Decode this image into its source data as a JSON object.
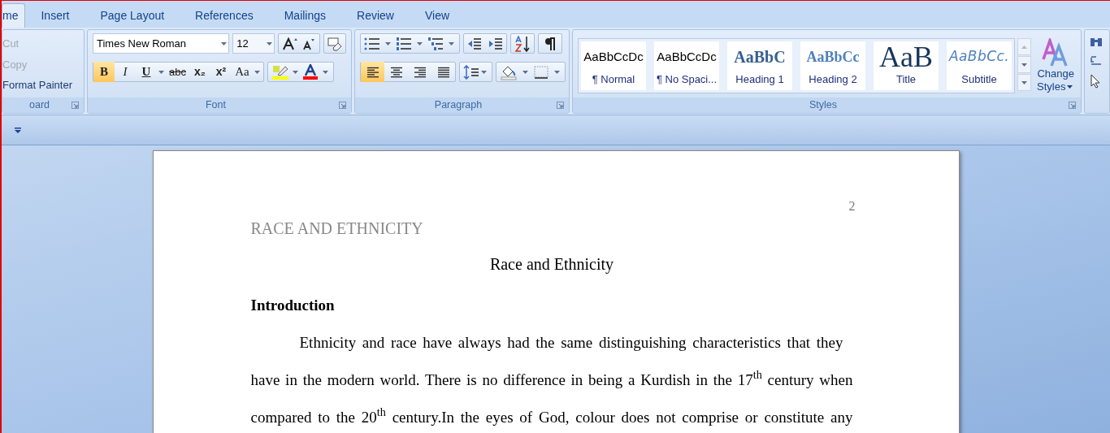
{
  "tabs": [
    {
      "label": "me",
      "selected": true
    },
    {
      "label": "Insert",
      "selected": false
    },
    {
      "label": "Page Layout",
      "selected": false
    },
    {
      "label": "References",
      "selected": false
    },
    {
      "label": "Mailings",
      "selected": false
    },
    {
      "label": "Review",
      "selected": false
    },
    {
      "label": "View",
      "selected": false
    }
  ],
  "clipboard": {
    "items": [
      {
        "label": "Cut",
        "disabled": true
      },
      {
        "label": "Copy",
        "disabled": true
      },
      {
        "label": "Format Painter",
        "disabled": false
      }
    ],
    "group_label": "oard"
  },
  "font": {
    "font_name": "Times New Roman",
    "font_size": "12",
    "group_label": "Font",
    "format_buttons": [
      {
        "label": "B",
        "kind": "bold",
        "selected": true
      },
      {
        "label": "I",
        "kind": "italic",
        "selected": false
      },
      {
        "label": "U",
        "kind": "underline",
        "selected": false
      },
      {
        "label": "abc",
        "kind": "strike",
        "selected": false
      },
      {
        "label": "x₂",
        "kind": "subscript",
        "selected": false
      },
      {
        "label": "x²",
        "kind": "superscript",
        "selected": false
      },
      {
        "label": "Aa",
        "kind": "case",
        "selected": false
      }
    ]
  },
  "paragraph": {
    "group_label": "Paragraph",
    "alignment": [
      {
        "kind": "left",
        "selected": true
      },
      {
        "kind": "center",
        "selected": false
      },
      {
        "kind": "right",
        "selected": false
      },
      {
        "kind": "justify",
        "selected": false
      }
    ]
  },
  "styles": {
    "group_label": "Styles",
    "items": [
      {
        "preview": "AaBbCcDc",
        "label": "¶ Normal",
        "kind": "normal"
      },
      {
        "preview": "AaBbCcDc",
        "label": "¶ No Spaci...",
        "kind": "plain"
      },
      {
        "preview": "AaBbC",
        "label": "Heading 1",
        "kind": "heading1"
      },
      {
        "preview": "AaBbCc",
        "label": "Heading 2",
        "kind": "heading2"
      },
      {
        "preview": "AaB",
        "label": "Title",
        "kind": "title"
      },
      {
        "preview": "AaBbCc.",
        "label": "Subtitle",
        "kind": "subtitle"
      }
    ],
    "change_styles": [
      "Change",
      "Styles"
    ]
  },
  "document": {
    "page_number": "2",
    "header": "RACE AND ETHNICITY",
    "title": "Race and Ethnicity",
    "heading": "Introduction",
    "lines": [
      "Ethnicity and race have always had the same distinguishing characteristics that they",
      "have in the modern world. There is no difference in being a Kurdish in the 17$^{th}$ century when",
      "compared to the 20$^{th}$ century.In the eyes of God, colour does not comprise or constitute any"
    ]
  }
}
